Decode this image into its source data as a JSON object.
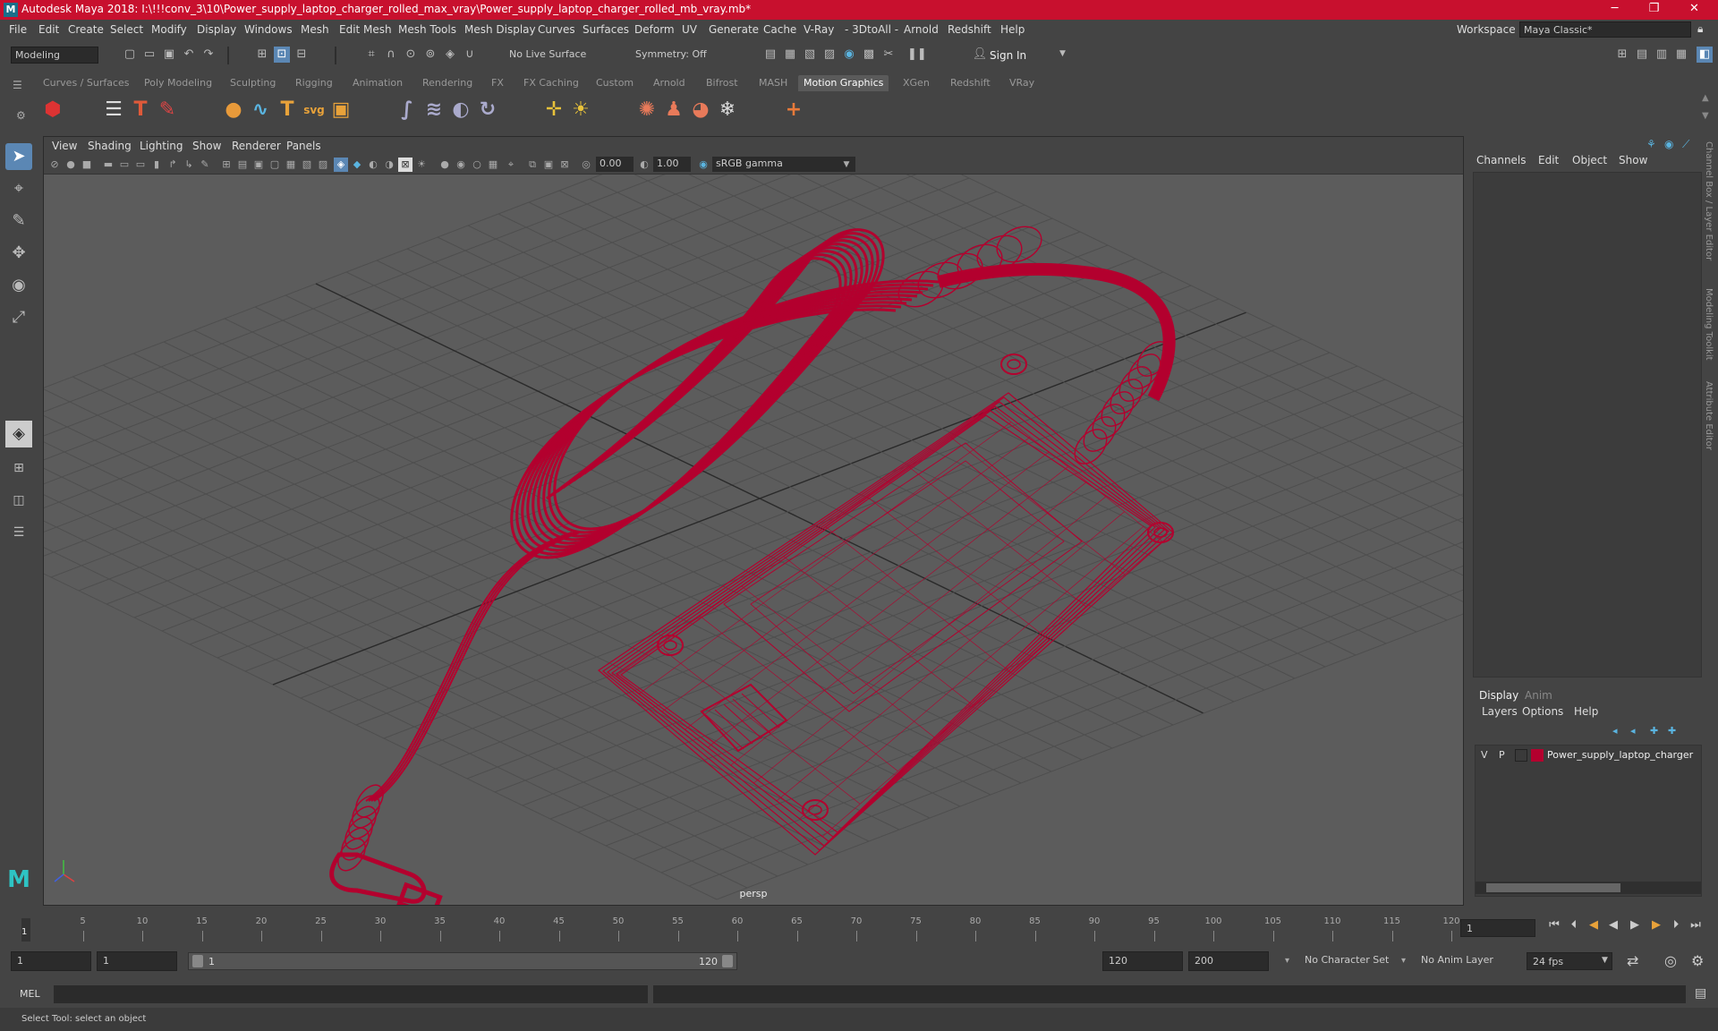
{
  "titlebar": {
    "logo": "M",
    "title": "Autodesk Maya 2018: I:\\!!!conv_3\\10\\Power_supply_laptop_charger_rolled_max_vray\\Power_supply_laptop_charger_rolled_mb_vray.mb*",
    "minimize": "─",
    "restore": "❐",
    "close": "✕"
  },
  "menubar": {
    "items": [
      "File",
      "Edit",
      "Create",
      "Select",
      "Modify",
      "Display",
      "Windows",
      "Mesh",
      "Edit Mesh",
      "Mesh Tools",
      "Mesh Display",
      "Curves",
      "Surfaces",
      "Deform",
      "UV",
      "Generate",
      "Cache",
      "V-Ray",
      "- 3DtoAll -",
      "Arnold",
      "Redshift",
      "Help"
    ],
    "workspace_label": "Workspace :",
    "workspace_value": "Maya Classic*"
  },
  "statusline": {
    "mode": "Modeling",
    "live_surface": "No Live Surface",
    "symmetry": "Symmetry: Off",
    "sign_in": "Sign In"
  },
  "shelf": {
    "tabs": [
      "Curves / Surfaces",
      "Poly Modeling",
      "Sculpting",
      "Rigging",
      "Animation",
      "Rendering",
      "FX",
      "FX Caching",
      "Custom",
      "Arnold",
      "Bifrost",
      "MASH",
      "Motion Graphics",
      "XGen",
      "Redshift",
      "VRay"
    ],
    "active_tab": "Motion Graphics",
    "svg_icon_text": "svg"
  },
  "viewport": {
    "menu": [
      "View",
      "Shading",
      "Lighting",
      "Show",
      "Renderer",
      "Panels"
    ],
    "exposure": "0.00",
    "gamma": "1.00",
    "color_space": "sRGB gamma",
    "camera": "persp",
    "wire_color": "#b3002e"
  },
  "channelbox": {
    "menu": [
      "Channels",
      "Edit",
      "Object",
      "Show"
    ]
  },
  "layers": {
    "tabs": [
      "Display",
      "Anim"
    ],
    "active_tab": "Display",
    "menu": [
      "Layers",
      "Options",
      "Help"
    ],
    "rows": [
      {
        "v": "V",
        "p": "P",
        "color": "#b3002e",
        "name": "Power_supply_laptop_charger"
      }
    ]
  },
  "side_tabs": [
    "Channel Box / Layer Editor",
    "Modeling Toolkit",
    "Attribute Editor"
  ],
  "timeline": {
    "ticks": [
      5,
      10,
      15,
      20,
      25,
      30,
      35,
      40,
      45,
      50,
      55,
      60,
      65,
      70,
      75,
      80,
      85,
      90,
      95,
      100,
      105,
      110,
      115,
      120
    ],
    "current_frame_marker": "1",
    "current_frame": "1"
  },
  "range": {
    "start": "1",
    "playback_start": "1",
    "slider_start": "1",
    "slider_end": "120",
    "playback_end": "120",
    "end": "200",
    "character_set": "No Character Set",
    "anim_layer": "No Anim Layer",
    "fps": "24 fps"
  },
  "cmdline": {
    "label": "MEL"
  },
  "helpline": {
    "text": "Select Tool: select an object"
  }
}
